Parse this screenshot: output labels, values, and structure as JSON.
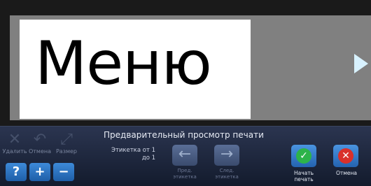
{
  "preview": {
    "label_text": "Меню"
  },
  "toolbar": {
    "delete_label": "Удалить",
    "undo_label": "Отмена",
    "size_label": "Размер",
    "help_glyph": "?",
    "zoom_in_glyph": "+",
    "zoom_out_glyph": "−"
  },
  "print_preview": {
    "title": "Предварительный просмотр печати",
    "label_count_line1": "Этикетка от 1",
    "label_count_line2": "до 1",
    "prev_label": "Пред. этикетка",
    "next_label": "След. этикетка",
    "start_label": "Начать печать",
    "cancel_label": "Отмена"
  },
  "colors": {
    "start": "#2db34a",
    "cancel": "#d9302b",
    "toolbar_bg": "#1f2a44"
  }
}
